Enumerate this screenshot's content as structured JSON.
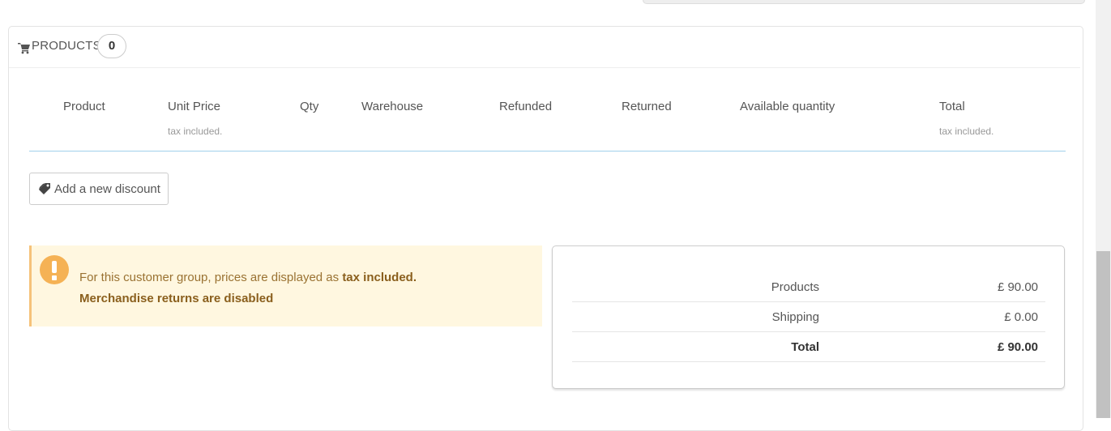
{
  "products_panel": {
    "title": "PRODUCTS",
    "count": "0",
    "icon": "shopping-cart-icon"
  },
  "table": {
    "columns": [
      {
        "label": "Product",
        "sub": ""
      },
      {
        "label": "Unit Price",
        "sub": "tax included."
      },
      {
        "label": "Qty",
        "sub": ""
      },
      {
        "label": "Warehouse",
        "sub": ""
      },
      {
        "label": "Refunded",
        "sub": ""
      },
      {
        "label": "Returned",
        "sub": ""
      },
      {
        "label": "Available quantity",
        "sub": ""
      },
      {
        "label": "Total",
        "sub": "tax included."
      }
    ]
  },
  "discount_button": {
    "label": "Add a new discount",
    "icon": "tag-icon"
  },
  "alert": {
    "text_prefix": "For this customer group, prices are displayed as ",
    "text_bold": "tax included.",
    "line2": "Merchandise returns are disabled",
    "icon": "exclamation-icon"
  },
  "totals": {
    "rows": [
      {
        "label": "Products",
        "value": "£ 90.00"
      },
      {
        "label": "Shipping",
        "value": "£ 0.00"
      },
      {
        "label": "Total",
        "value": "£ 90.00"
      }
    ]
  },
  "colors": {
    "alert_bg": "#fff7e0",
    "alert_border": "#f6c27a",
    "alert_icon": "#f5b255",
    "table_rule": "#a0d0eb"
  }
}
